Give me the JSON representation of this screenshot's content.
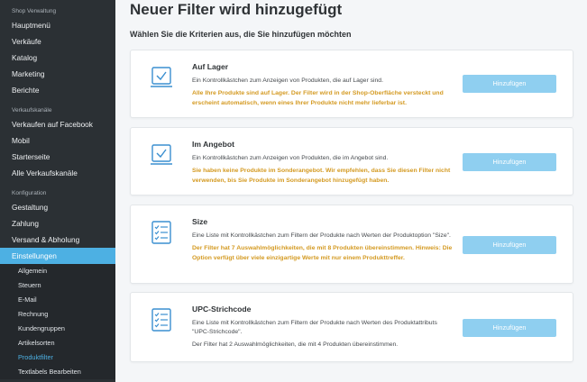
{
  "sidebar": {
    "sections": [
      {
        "title": "Shop Verwaltung",
        "items": [
          "Hauptmenü",
          "Verkäufe",
          "Katalog",
          "Marketing",
          "Berichte"
        ]
      },
      {
        "title": "Verkaufskanäle",
        "items": [
          "Verkaufen auf Facebook",
          "Mobil",
          "Starterseite",
          "Alle Verkaufskanäle"
        ]
      },
      {
        "title": "Konfiguration",
        "items": [
          "Gestaltung",
          "Zahlung",
          "Versand & Abholung",
          "Einstellungen"
        ]
      }
    ],
    "active_item": "Einstellungen",
    "subitems": [
      "Allgemein",
      "Steuern",
      "E-Mail",
      "Rechnung",
      "Kundengruppen",
      "Artikelsorten",
      "Produktfilter",
      "Textlabels Bearbeiten"
    ],
    "active_subitem": "Produktfilter"
  },
  "main": {
    "title": "Neuer Filter wird hinzugefügt",
    "subtitle": "Wählen Sie die Kriterien aus, die Sie hinzufügen möchten",
    "button_label": "Hinzufügen",
    "colors": {
      "accent": "#4db0e3",
      "button": "#8fcff0",
      "warning": "#d49a22",
      "sidebar": "#2b3034"
    },
    "cards": [
      {
        "icon": "checkbox-icon",
        "title": "Auf Lager",
        "description": "Ein Kontrollkästchen zum Anzeigen von Produkten, die auf Lager sind.",
        "warning": "Alle Ihre Produkte sind auf Lager. Der Filter wird in der Shop-Oberfläche versteckt und erscheint automatisch, wenn eines Ihrer Produkte nicht mehr lieferbar ist.",
        "note": ""
      },
      {
        "icon": "checkbox-icon",
        "title": "Im Angebot",
        "description": "Ein Kontrollkästchen zum Anzeigen von Produkten, die im Angebot sind.",
        "warning": "Sie haben keine Produkte im Sonderangebot. Wir empfehlen, dass Sie diesen Filter nicht verwenden, bis Sie Produkte im Sonderangebot hinzugefügt haben.",
        "note": ""
      },
      {
        "icon": "checklist-icon",
        "title": "Size",
        "description": "Eine Liste mit Kontrollkästchen zum Filtern der Produkte nach Werten der Produktoption \"Size\".",
        "warning": "Der Filter hat 7 Auswahlmöglichkeiten, die mit 8 Produkten übereinstimmen. Hinweis: Die Option verfügt über viele einzigartige Werte mit nur einem Produkttreffer.",
        "note": ""
      },
      {
        "icon": "checklist-icon",
        "title": "UPC-Strichcode",
        "description": "Eine Liste mit Kontrollkästchen zum Filtern der Produkte nach Werten des Produktattributs \"UPC-Strichcode\".",
        "warning": "",
        "note": "Der Filter hat 2 Auswahlmöglichkeiten, die mit 4 Produkten übereinstimmen."
      }
    ]
  }
}
